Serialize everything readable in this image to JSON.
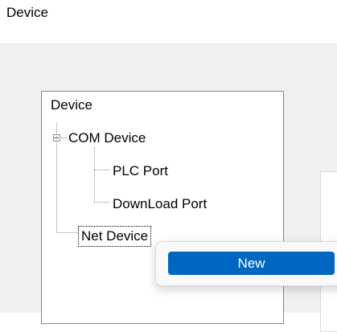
{
  "window": {
    "title": "Device"
  },
  "tree": {
    "root": "Device",
    "items": [
      {
        "label": "COM Device",
        "expanded": true,
        "children": [
          {
            "label": "PLC Port"
          },
          {
            "label": "DownLoad Port"
          }
        ]
      },
      {
        "label": "Net Device",
        "selected": true
      }
    ]
  },
  "context_menu": {
    "items": [
      {
        "label": "New",
        "highlighted": true
      }
    ]
  },
  "colors": {
    "content_background": "#f0f0f0",
    "menu_highlight": "#0067c0"
  }
}
